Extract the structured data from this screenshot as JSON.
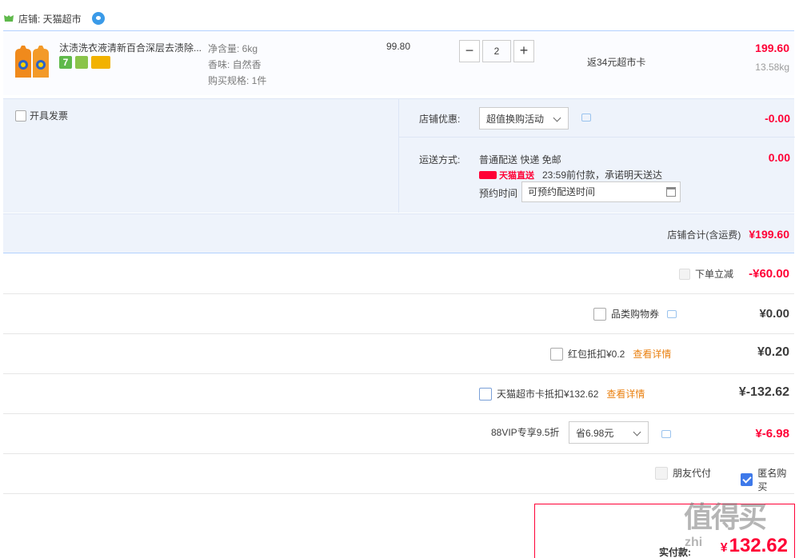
{
  "shop": {
    "label": "店铺: 天猫超市"
  },
  "item": {
    "title": "汰渍洗衣液清新百合深层去渍除...",
    "badges": [
      "7",
      "",
      ""
    ],
    "sku_net": "净含量: 6kg",
    "sku_scent": "香味: 自然香",
    "sku_spec": "购买规格: 1件",
    "unit_price": "99.80",
    "qty_minus": "−",
    "qty_value": "2",
    "qty_plus": "+",
    "rebate": "返34元超市卡",
    "subtotal": "199.60",
    "weight": "13.58kg"
  },
  "invoice": {
    "label": "开具发票"
  },
  "shop_promo": {
    "label": "店铺优惠:",
    "selected": "超值换购活动",
    "amount": "-0.00"
  },
  "shipping": {
    "label": "运送方式:",
    "method": "普通配送 快递 免邮",
    "tmall_direct": "天猫直送",
    "promise": "23:59前付款，承诺明天送达",
    "reserve_label": "预约时间",
    "reserve_placeholder": "可预约配送时间",
    "amount": "0.00"
  },
  "shop_total": {
    "label": "店铺合计(含运费)",
    "amount": "¥199.60"
  },
  "discounts": {
    "instant": {
      "label": "下单立减",
      "amount": "-¥60.00"
    },
    "coupon": {
      "label": "品类购物券",
      "amount": "¥0.00"
    },
    "redpacket": {
      "label": "红包抵扣¥0.2",
      "link": "查看详情",
      "amount": "¥0.20"
    },
    "tmcard": {
      "label": "天猫超市卡抵扣¥132.62",
      "link": "查看详情",
      "amount": "¥-132.62"
    },
    "vip": {
      "label": "88VIP专享9.5折",
      "selected": "省6.98元",
      "amount": "¥-6.98"
    }
  },
  "options": {
    "friend_pay": "朋友代付",
    "anonymous": "匿名购买"
  },
  "pay": {
    "label": "实付款:",
    "yen": "¥",
    "amount": "132.62"
  },
  "watermark": {
    "text": "值得买",
    "url": "zhi"
  },
  "colors": {
    "accent_red": "#ff0036",
    "panel_blue": "#eef3fb",
    "link_orange": "#ea8010"
  }
}
